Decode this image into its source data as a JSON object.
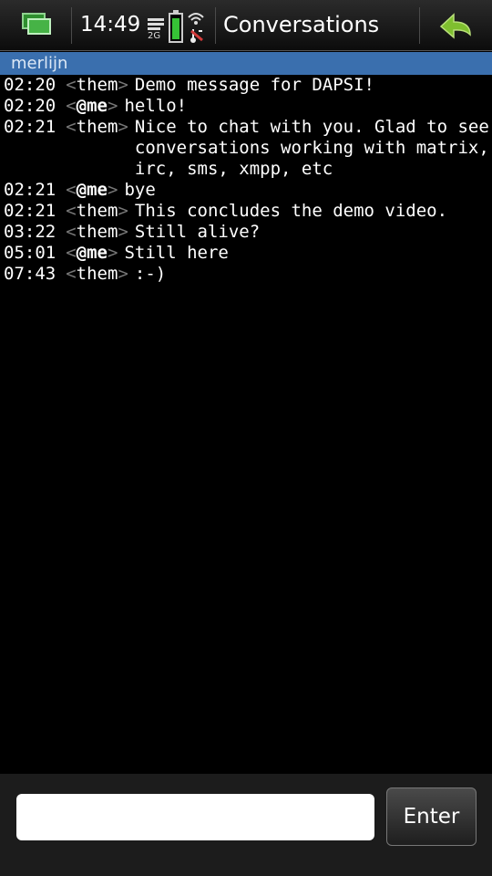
{
  "status_bar": {
    "time": "14:49",
    "network": "2G",
    "title": "Conversations"
  },
  "contact": {
    "name": "merlijn"
  },
  "messages": [
    {
      "time": "02:20",
      "nick": "them",
      "text": "Demo message for DAPSI!"
    },
    {
      "time": "02:20",
      "nick": "@me",
      "text": "hello!"
    },
    {
      "time": "02:21",
      "nick": "them",
      "text": "Nice to chat with you. Glad to see\nconversations working with matrix,\nirc, sms, xmpp, etc"
    },
    {
      "time": "02:21",
      "nick": "@me",
      "text": "bye"
    },
    {
      "time": "02:21",
      "nick": "them",
      "text": "This concludes the demo video."
    },
    {
      "time": "03:22",
      "nick": "them",
      "text": "Still alive?"
    },
    {
      "time": "05:01",
      "nick": "@me",
      "text": "Still here"
    },
    {
      "time": "07:43",
      "nick": "them",
      "text": ":-)"
    }
  ],
  "nick_brackets": {
    "open": "<",
    "close": ">"
  },
  "input": {
    "value": "",
    "placeholder": ""
  },
  "enter_label": "Enter",
  "colors": {
    "contact_bar": "#3a6fae",
    "battery": "#36c236",
    "back_arrow": "#7fbf2f"
  },
  "icons": {
    "task_switcher": "task-switcher-icon",
    "signal": "signal-icon",
    "battery": "battery-icon",
    "wifi": "wifi-icon",
    "back": "back-arrow-icon"
  },
  "battery_level": 0.9
}
